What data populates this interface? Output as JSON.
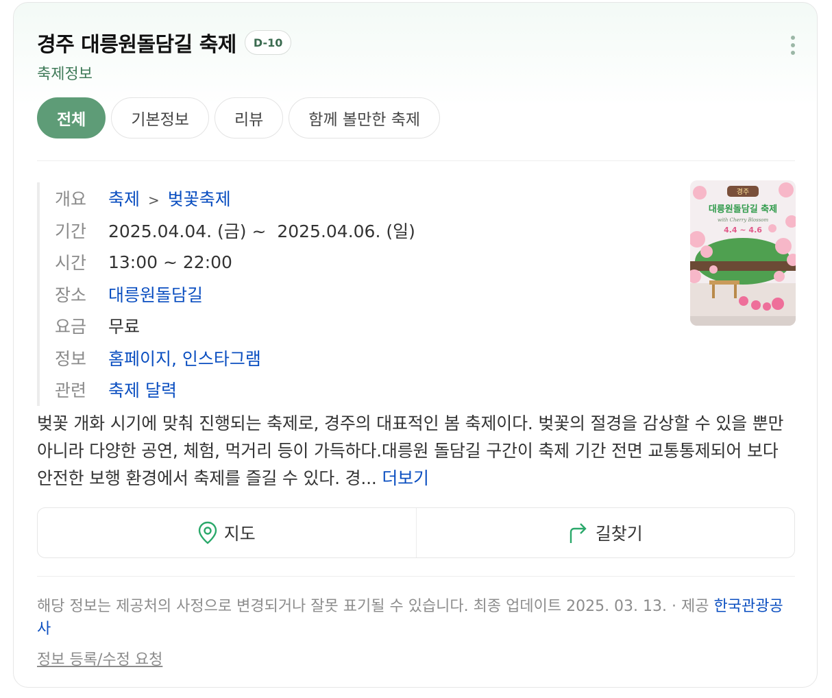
{
  "header": {
    "title": "경주 대릉원돌담길 축제",
    "dday": "D-10",
    "subtitle": "축제정보"
  },
  "tabs": [
    {
      "label": "전체",
      "active": true
    },
    {
      "label": "기본정보",
      "active": false
    },
    {
      "label": "리뷰",
      "active": false
    },
    {
      "label": "함께 볼만한 축제",
      "active": false
    }
  ],
  "info": {
    "overview": {
      "label": "개요",
      "cat1": "축제",
      "sep": ">",
      "cat2": "벚꽃축제"
    },
    "period": {
      "label": "기간",
      "value": "2025.04.04. (금) ~  2025.04.06. (일)"
    },
    "time": {
      "label": "시간",
      "value": "13:00 ~ 22:00"
    },
    "place": {
      "label": "장소",
      "value": "대릉원돌담길"
    },
    "fee": {
      "label": "요금",
      "value": "무료"
    },
    "links": {
      "label": "정보",
      "homepage": "홈페이지",
      "comma": ",",
      "instagram": "인스타그램"
    },
    "related": {
      "label": "관련",
      "value": "축제 달력"
    }
  },
  "poster": {
    "top_text": "경주",
    "title": "대릉원돌담길 축제",
    "script_text": "with Cherry Blossom",
    "dates": "4.4 ~ 4.6"
  },
  "description": {
    "text": "벚꽃 개화 시기에 맞춰 진행되는 축제로, 경주의 대표적인 봄 축제이다. 벚꽃의 절경을 감상할 수 있을 뿐만 아니라 다양한 공연, 체험, 먹거리 등이 가득하다.대릉원 돌담길 구간이 축제 기간 전면 교통통제되어 보다 안전한 보행 환경에서 축제를 즐길 수 있다. 경...",
    "more": "더보기"
  },
  "actions": {
    "map": "지도",
    "directions": "길찾기"
  },
  "footer": {
    "notice": "해당 정보는 제공처의 사정으로 변경되거나 잘못 표기될 수 있습니다. 최종 업데이트 2025. 03. 13.",
    "provider_prefix": "제공",
    "provider": "한국관광공사",
    "request": "정보 등록/수정 요청"
  },
  "colors": {
    "accent": "#5e9c77",
    "link": "#0a4ec0",
    "subtitle": "#3f7a58"
  }
}
